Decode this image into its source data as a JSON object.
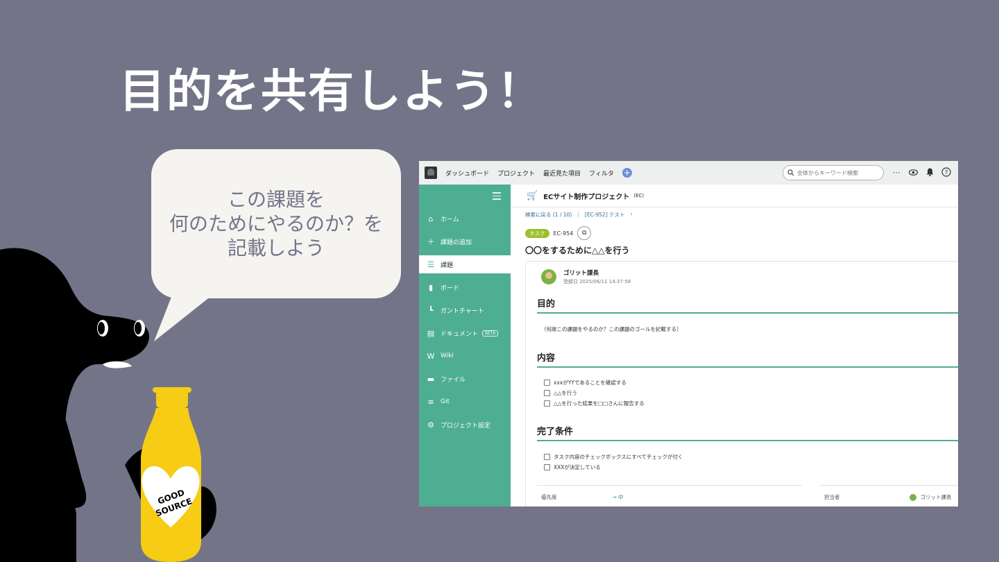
{
  "slide": {
    "title": "目的を共有しよう！",
    "bubble_lines": [
      "この課題を",
      "何のためにやるのか？を",
      "記載しよう"
    ],
    "bottle_label_line1": "GOOD",
    "bottle_label_line2": "SOURCE"
  },
  "app": {
    "topbar": {
      "nav": [
        "ダッシュボード",
        "プロジェクト",
        "最近見た項目",
        "フィルタ"
      ],
      "add_label": "+",
      "search_placeholder": "全体からキーワード検索",
      "icons": [
        "more-icon",
        "watch-icon",
        "bell-icon",
        "help-icon"
      ]
    },
    "sidebar": {
      "items": [
        {
          "label": "ホーム",
          "icon": "home-icon"
        },
        {
          "label": "課題の追加",
          "icon": "plus-icon"
        },
        {
          "label": "課題",
          "icon": "list-icon",
          "active": true
        },
        {
          "label": "ボード",
          "icon": "board-icon"
        },
        {
          "label": "ガントチャート",
          "icon": "gantt-icon"
        },
        {
          "label": "ドキュメント",
          "icon": "document-icon",
          "badge": "BETA"
        },
        {
          "label": "Wiki",
          "icon": "wiki-icon"
        },
        {
          "label": "ファイル",
          "icon": "file-icon"
        },
        {
          "label": "Git",
          "icon": "git-icon"
        },
        {
          "label": "プロジェクト設定",
          "icon": "gear-icon"
        }
      ]
    },
    "project": {
      "name": "ECサイト制作プロジェクト",
      "key": "(EC)"
    },
    "breadcrumb": {
      "back": "検索に戻る (1 / 10)",
      "parent": "[EC-952] テスト"
    },
    "issue": {
      "type": "タスク",
      "key": "EC-954",
      "title": "〇〇をするために△△を行う",
      "author": "ゴリット課長",
      "date": "登録日 2025/06/11 14:37:58",
      "sections": {
        "purpose_heading": "目的",
        "purpose_text": "（何故この課題をやるのか？この課題のゴールを記載する）",
        "content_heading": "内容",
        "content_items": [
          "xxxがYYであることを確認する",
          "△△を行う",
          "△△を行った結果を□□さんに報告する"
        ],
        "done_heading": "完了条件",
        "done_items": [
          "タスク内容のチェックボックスにすべてチェックが付く",
          "XXXが決定している"
        ]
      },
      "fields": {
        "priority_label": "優先度",
        "priority_value": "→ 中",
        "assignee_label": "担当者",
        "assignee_value": "ゴリット課長"
      }
    }
  },
  "colors": {
    "background": "#747489",
    "sidebar": "#4eae92",
    "bubble": "#f6f4f0",
    "bottle": "#f6cc14"
  }
}
